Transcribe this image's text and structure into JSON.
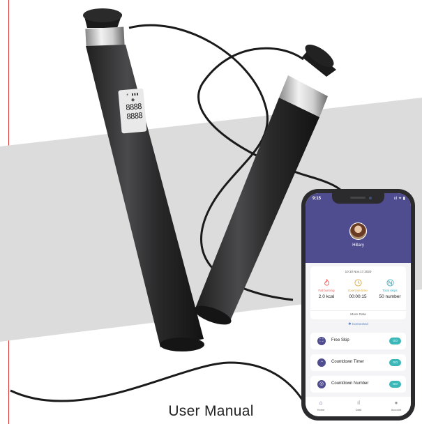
{
  "caption": "User Manual",
  "handle_display": {
    "digits_top": "8888",
    "digits_bottom": "8888"
  },
  "phone": {
    "status_time": "9:15",
    "status_icons": "ııl ✦ ▮",
    "user_name": "Hillary",
    "stats": {
      "date": "10:10 Nov.17,2020",
      "items": [
        {
          "label": "Fat burning",
          "value": "2.0 kcal",
          "color": "#e85a5a",
          "icon": "flame-icon"
        },
        {
          "label": "Exercise time",
          "value": "00:00:15",
          "color": "#e0a935",
          "icon": "clock-icon"
        },
        {
          "label": "Total skips",
          "value": "50 number",
          "color": "#3bb0c9",
          "icon": "n-count-icon"
        }
      ],
      "more_label": "More Data"
    },
    "connected_label": "✱ Connected",
    "menu": [
      {
        "label": "Free Skip",
        "go": "GO"
      },
      {
        "label": "Countdown Timer",
        "go": "GO"
      },
      {
        "label": "Countdown Number",
        "go": "GO"
      }
    ],
    "tabs": [
      {
        "label": "Home",
        "icon": "home-icon"
      },
      {
        "label": "Data",
        "icon": "bar-chart-icon"
      },
      {
        "label": "Account",
        "icon": "person-icon"
      }
    ],
    "accent": "#4f4c8f",
    "go_color": "#3cb6b7"
  }
}
